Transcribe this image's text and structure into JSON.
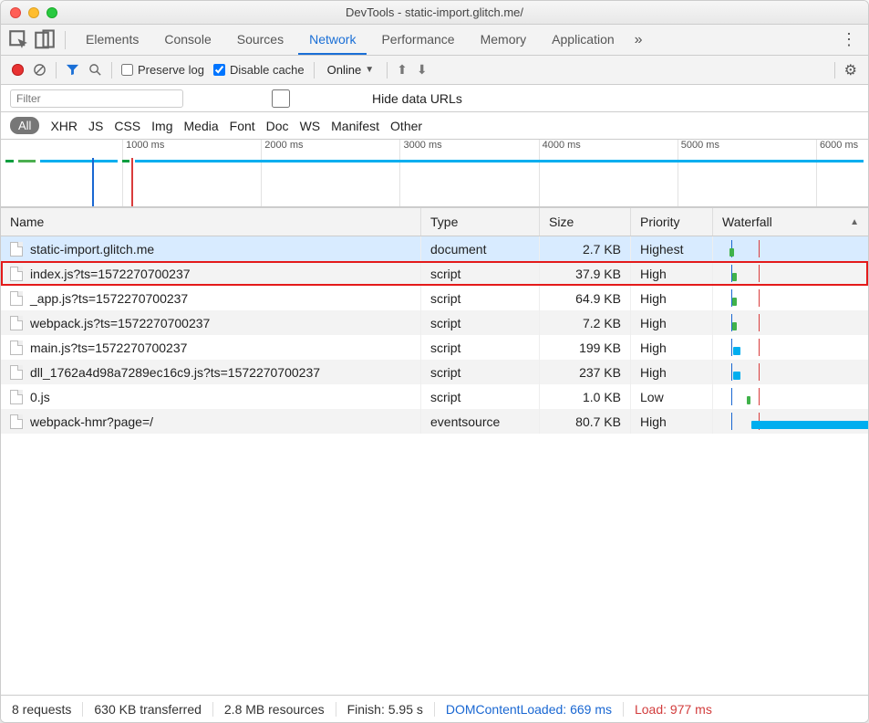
{
  "window": {
    "title": "DevTools - static-import.glitch.me/"
  },
  "tabs": {
    "items": [
      "Elements",
      "Console",
      "Sources",
      "Network",
      "Performance",
      "Memory",
      "Application"
    ],
    "active": "Network"
  },
  "toolbar": {
    "preserve_log": "Preserve log",
    "disable_cache": "Disable cache",
    "throttle": "Online"
  },
  "filterbar": {
    "filter_placeholder": "Filter",
    "hide_data_urls": "Hide data URLs"
  },
  "typefilters": [
    "All",
    "XHR",
    "JS",
    "CSS",
    "Img",
    "Media",
    "Font",
    "Doc",
    "WS",
    "Manifest",
    "Other"
  ],
  "timeline_ticks": [
    "1000 ms",
    "2000 ms",
    "3000 ms",
    "4000 ms",
    "5000 ms",
    "6000 ms"
  ],
  "columns": {
    "name": "Name",
    "type": "Type",
    "size": "Size",
    "priority": "Priority",
    "waterfall": "Waterfall"
  },
  "requests": [
    {
      "name": "static-import.glitch.me",
      "type": "document",
      "size": "2.7 KB",
      "priority": "Highest",
      "wf": {
        "start": 8,
        "width": 5,
        "class": "green"
      },
      "selected": true
    },
    {
      "name": "index.js?ts=1572270700237",
      "type": "script",
      "size": "37.9 KB",
      "priority": "High",
      "wf": {
        "start": 11,
        "width": 5,
        "class": "green"
      },
      "highlighted": true
    },
    {
      "name": "_app.js?ts=1572270700237",
      "type": "script",
      "size": "64.9 KB",
      "priority": "High",
      "wf": {
        "start": 11,
        "width": 5,
        "class": "green"
      }
    },
    {
      "name": "webpack.js?ts=1572270700237",
      "type": "script",
      "size": "7.2 KB",
      "priority": "High",
      "wf": {
        "start": 11,
        "width": 5,
        "class": "green"
      }
    },
    {
      "name": "main.js?ts=1572270700237",
      "type": "script",
      "size": "199 KB",
      "priority": "High",
      "wf": {
        "start": 12,
        "width": 8,
        "class": "blue"
      }
    },
    {
      "name": "dll_1762a4d98a7289ec16c9.js?ts=1572270700237",
      "type": "script",
      "size": "237 KB",
      "priority": "High",
      "wf": {
        "start": 12,
        "width": 8,
        "class": "blue"
      }
    },
    {
      "name": "0.js",
      "type": "script",
      "size": "1.0 KB",
      "priority": "Low",
      "wf": {
        "start": 27,
        "width": 4,
        "class": "green"
      }
    },
    {
      "name": "webpack-hmr?page=/",
      "type": "eventsource",
      "size": "80.7 KB",
      "priority": "High",
      "wf": {
        "start": 32,
        "width": 138,
        "class": "blue"
      }
    }
  ],
  "status": {
    "requests": "8 requests",
    "transferred": "630 KB transferred",
    "resources": "2.8 MB resources",
    "finish": "Finish: 5.95 s",
    "dcl": "DOMContentLoaded: 669 ms",
    "load": "Load: 977 ms"
  }
}
